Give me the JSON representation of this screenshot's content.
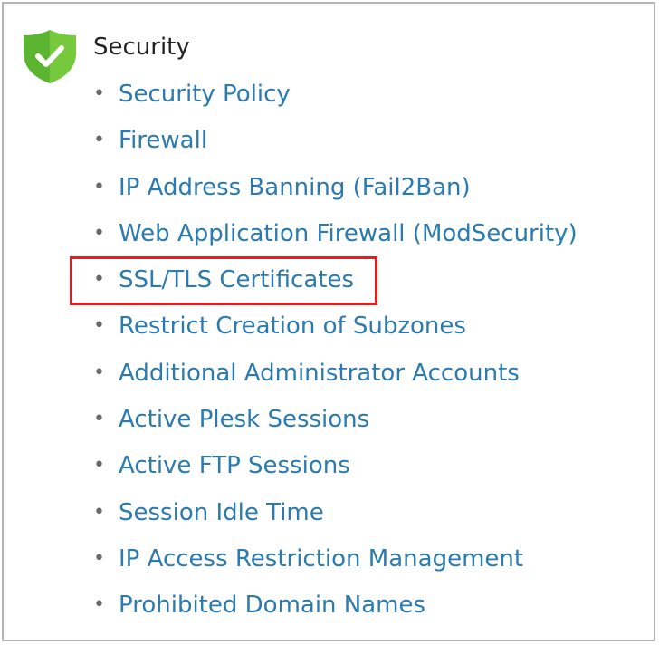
{
  "section": {
    "title": "Security",
    "icon": "shield-check-icon",
    "colors": {
      "shield": "#6dbf3b",
      "link": "#2b7bb0",
      "highlight": "#e02020"
    }
  },
  "links": [
    {
      "label": "Security Policy"
    },
    {
      "label": "Firewall"
    },
    {
      "label": "IP Address Banning (Fail2Ban)"
    },
    {
      "label": "Web Application Firewall (ModSecurity)"
    },
    {
      "label": "SSL/TLS Certificates",
      "highlighted": true
    },
    {
      "label": "Restrict Creation of Subzones"
    },
    {
      "label": "Additional Administrator Accounts"
    },
    {
      "label": "Active Plesk Sessions"
    },
    {
      "label": "Active FTP Sessions"
    },
    {
      "label": "Session Idle Time"
    },
    {
      "label": "IP Access Restriction Management"
    },
    {
      "label": "Prohibited Domain Names"
    }
  ]
}
